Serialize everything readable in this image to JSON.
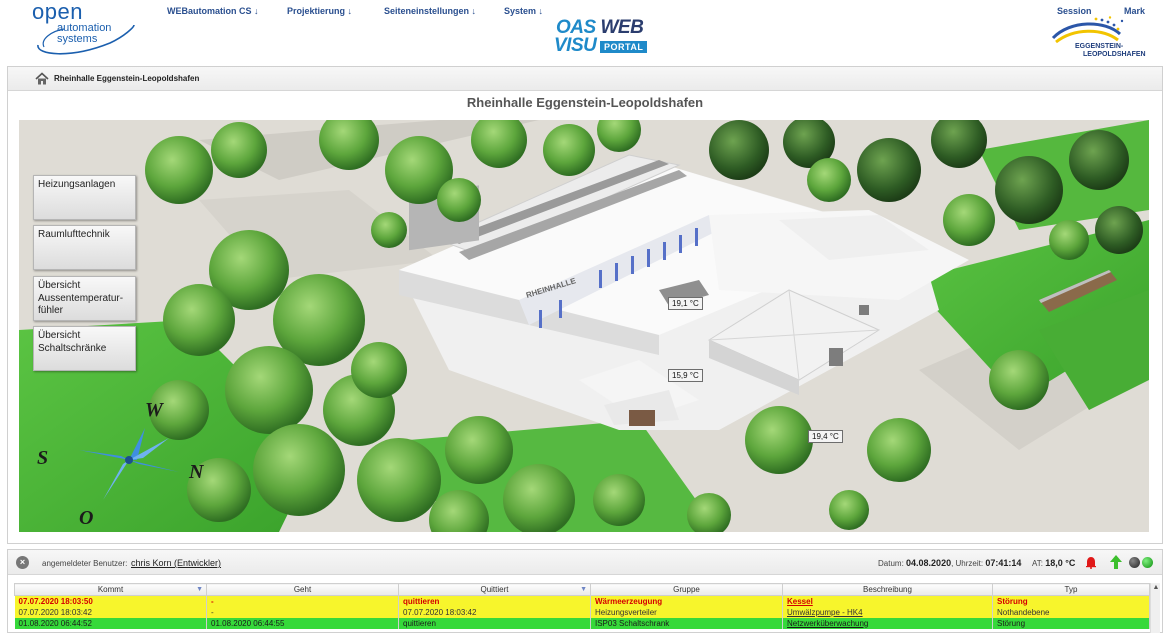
{
  "header": {
    "logo": {
      "line1": "open",
      "line2": "automation",
      "line3": "systems"
    },
    "nav": {
      "webautomation": "WEBautomation CS ↓",
      "projektierung": "Projektierung ↓",
      "seiteneinstellungen": "Seiteneinstellungen ↓",
      "system": "System ↓",
      "session": "Session",
      "mark": "Mark"
    },
    "brand": {
      "oas": "OAS",
      "web": "WEB",
      "visu": "VISU",
      "portal": "PORTAL"
    },
    "municipality": {
      "line1": "EGGENSTEIN-",
      "line2": "LEOPOLDSHAFEN"
    }
  },
  "breadcrumb": {
    "text": "Rheinhalle Eggenstein-Leopoldshafen"
  },
  "page_title": "Rheinhalle Eggenstein-Leopoldshafen",
  "side_buttons": [
    {
      "label": "Heizungsanlagen"
    },
    {
      "label": "Raumlufttechnik"
    },
    {
      "label": "Übersicht Aussentemperatur-fühler"
    },
    {
      "label": "Übersicht Schaltschränke"
    }
  ],
  "building_label": "RHEINHALLE",
  "compass": {
    "n": "N",
    "o": "O",
    "s": "S",
    "w": "W"
  },
  "temperatures": {
    "t1": "19,1 °C",
    "t2": "15,9 °C",
    "t3": "19,4 °C"
  },
  "status": {
    "user_label": "angemeldeter Benutzer:",
    "user_name": "chris Korn (Entwickler)",
    "datum_label": "Datum:",
    "datum_value": "04.08.2020",
    "uhrzeit_label": "Uhrzeit:",
    "uhrzeit_value": "07:41:14",
    "at_label": "AT:",
    "at_value": "18,0 °C"
  },
  "alarm_table": {
    "columns": [
      "Kommt",
      "Geht",
      "Quittiert",
      "Gruppe",
      "Beschreibung",
      "Typ"
    ],
    "rows": [
      {
        "kommt": "07.07.2020 18:03:50",
        "geht": "-",
        "quittiert": "quittieren",
        "gruppe": "Wärmeerzeugung",
        "beschreibung": "Kessel",
        "typ": "Störung"
      },
      {
        "kommt": "07.07.2020 18:03:42",
        "geht": "-",
        "quittiert": "07.07.2020 18:03:42",
        "gruppe": "Heizungsverteiler",
        "beschreibung": "Umwälzpumpe - HK4",
        "typ": "Nothandebene"
      },
      {
        "kommt": "01.08.2020 06:44:52",
        "geht": "01.08.2020 06:44:55",
        "quittiert": "quittieren",
        "gruppe": "ISP03 Schaltschrank",
        "beschreibung": "Netzwerküberwachung",
        "typ": "Störung"
      }
    ]
  }
}
